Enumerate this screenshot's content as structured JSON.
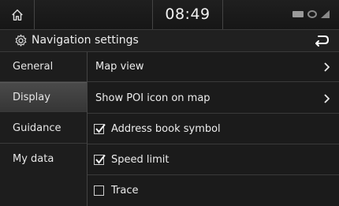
{
  "status": {
    "time": "08:49"
  },
  "header": {
    "title": "Navigation settings"
  },
  "sidebar": {
    "items": [
      {
        "label": "General"
      },
      {
        "label": "Display"
      },
      {
        "label": "Guidance"
      },
      {
        "label": "My data"
      }
    ],
    "active": "Display"
  },
  "main": {
    "rows": [
      {
        "label": "Map view",
        "kind": "submenu"
      },
      {
        "label": "Show POI icon on map",
        "kind": "submenu"
      },
      {
        "label": "Address book symbol",
        "kind": "checkbox",
        "checked": true
      },
      {
        "label": "Speed limit",
        "kind": "checkbox",
        "checked": true
      },
      {
        "label": "Trace",
        "kind": "checkbox",
        "checked": false
      }
    ]
  },
  "colors": {
    "background": "#1b1b1b",
    "text": "#ececec",
    "active_item": "#444444"
  },
  "icons": {
    "home": "home-icon",
    "settings": "gear-icon",
    "back": "back-arrow-icon",
    "chevron": "chevron-right-icon",
    "checkbox": "checkbox-icon"
  }
}
